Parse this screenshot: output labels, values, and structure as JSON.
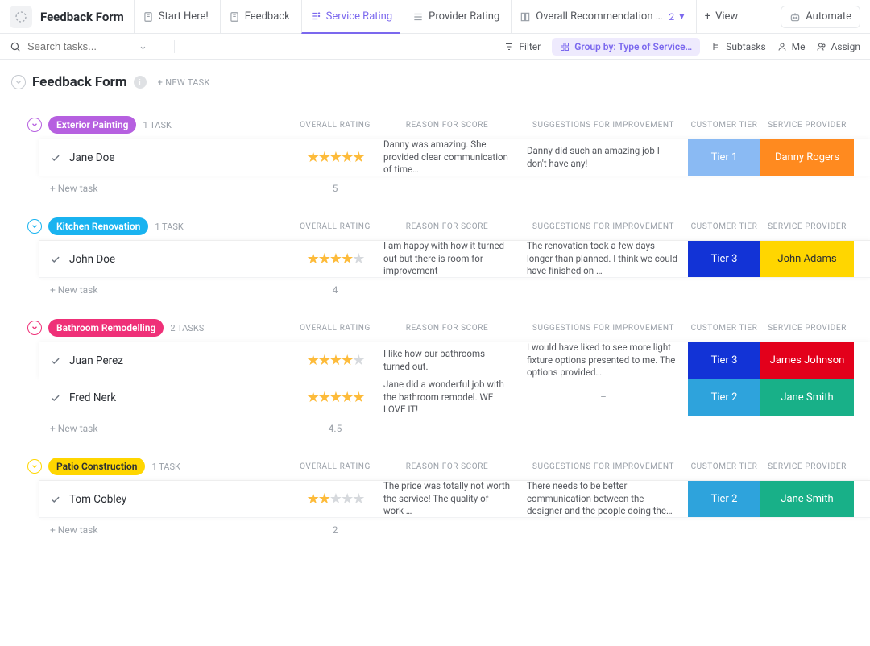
{
  "header": {
    "title": "Feedback Form",
    "tabs": [
      {
        "label": "Start Here!"
      },
      {
        "label": "Feedback"
      },
      {
        "label": "Service Rating",
        "active": true
      },
      {
        "label": "Provider Rating"
      },
      {
        "label": "Overall Recommendation …",
        "count": "2"
      }
    ],
    "view_btn": "View",
    "automate_btn": "Automate"
  },
  "toolbar": {
    "search_placeholder": "Search tasks...",
    "filter": "Filter",
    "groupby": "Group by: Type of Service…",
    "subtasks": "Subtasks",
    "me": "Me",
    "assign": "Assign"
  },
  "list": {
    "title": "Feedback Form",
    "new_task": "+ NEW TASK"
  },
  "columns": {
    "rating": "OVERALL RATING",
    "reason": "REASON FOR SCORE",
    "sugg": "SUGGESTIONS FOR IMPROVEMENT",
    "tier": "CUSTOMER TIER",
    "provider": "SERVICE PROVIDER"
  },
  "add_row_label": "+ New task",
  "groups": [
    {
      "name": "Exterior Painting",
      "color": "#b660e0",
      "chev": "#b660e0",
      "count_label": "1 TASK",
      "avg": "5",
      "tasks": [
        {
          "name": "Jane Doe",
          "stars": 5,
          "reason": "Danny was amazing. She provid­ed clear communication of time…",
          "sugg": "Danny did such an amazing job I don't have any!",
          "tier": "Tier 1",
          "tier_bg": "#8abaf3",
          "provider": "Danny Rogers",
          "provider_bg": "#ff8a1f"
        }
      ]
    },
    {
      "name": "Kitchen Renovation",
      "color": "#19b3f0",
      "chev": "#19b3f0",
      "count_label": "1 TASK",
      "avg": "4",
      "tasks": [
        {
          "name": "John Doe",
          "stars": 4,
          "reason": "I am happy with how it turned out but there is room for improvement",
          "sugg": "The renovation took a few days longer than planned. I think we could have finished on …",
          "tier": "Tier 3",
          "tier_bg": "#1233d6",
          "provider": "John Adams",
          "provider_bg": "#ffd600",
          "provider_fg": "#2a2e34"
        }
      ]
    },
    {
      "name": "Bathroom Remodelling",
      "color": "#ef3078",
      "chev": "#ef3078",
      "count_label": "2 TASKS",
      "avg": "4.5",
      "tasks": [
        {
          "name": "Juan Perez",
          "stars": 4,
          "reason": "I like how our bathrooms turned out.",
          "sugg": "I would have liked to see more light fixture op­tions presented to me. The options provided…",
          "tier": "Tier 3",
          "tier_bg": "#1233d6",
          "provider": "James Johnson",
          "provider_bg": "#e3001b"
        },
        {
          "name": "Fred Nerk",
          "stars": 5,
          "reason": "Jane did a wonderful job with the bathroom remodel. WE LOVE IT!",
          "sugg": "–",
          "tier": "Tier 2",
          "tier_bg": "#2ea3dc",
          "provider": "Jane Smith",
          "provider_bg": "#18b088"
        }
      ]
    },
    {
      "name": "Patio Construction",
      "color": "#ffd600",
      "chev": "#ffd600",
      "pill_fg": "#2a2e34",
      "count_label": "1 TASK",
      "avg": "2",
      "tasks": [
        {
          "name": "Tom Cobley",
          "stars": 2,
          "reason": "The price was totally not worth the service! The quality of work …",
          "sugg": "There needs to be better communication be­tween the designer and the people doing the…",
          "tier": "Tier 2",
          "tier_bg": "#2ea3dc",
          "provider": "Jane Smith",
          "provider_bg": "#18b088"
        }
      ]
    }
  ]
}
